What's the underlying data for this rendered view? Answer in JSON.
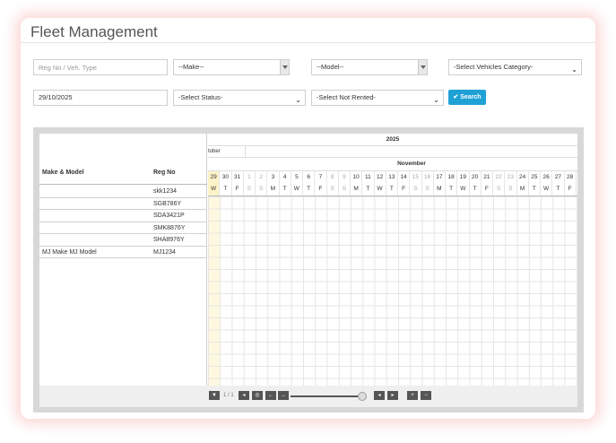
{
  "page": {
    "title": "Fleet Management"
  },
  "filters": {
    "reg_placeholder": "Reg No / Veh. Type",
    "make": "--Make--",
    "model": "--Model--",
    "vehicle_category": "-Select Vehicles Category-",
    "date": "29/10/2025",
    "status": "-Select Status-",
    "not_rented": "-Select Not Rented-",
    "search_label": "Search"
  },
  "gantt": {
    "year": "2025",
    "month_partial": "tober",
    "month_main": "November",
    "headers": {
      "make_model": "Make & Model",
      "reg_no": "Reg No"
    },
    "rows": [
      {
        "make_model": "",
        "reg_no": "skk1234"
      },
      {
        "make_model": "",
        "reg_no": "SGB786Y"
      },
      {
        "make_model": "",
        "reg_no": "SDA3421P"
      },
      {
        "make_model": "",
        "reg_no": "SMK8876Y"
      },
      {
        "make_model": "",
        "reg_no": "SHA8976Y"
      },
      {
        "make_model": "MJ Make MJ Model",
        "reg_no": "MJ1234"
      }
    ],
    "days": [
      {
        "d": "29",
        "w": "W",
        "weekend": false,
        "today": true
      },
      {
        "d": "30",
        "w": "T",
        "weekend": false
      },
      {
        "d": "31",
        "w": "F",
        "weekend": false
      },
      {
        "d": "1",
        "w": "S",
        "weekend": true
      },
      {
        "d": "2",
        "w": "S",
        "weekend": true
      },
      {
        "d": "3",
        "w": "M",
        "weekend": false
      },
      {
        "d": "4",
        "w": "T",
        "weekend": false
      },
      {
        "d": "5",
        "w": "W",
        "weekend": false
      },
      {
        "d": "6",
        "w": "T",
        "weekend": false
      },
      {
        "d": "7",
        "w": "F",
        "weekend": false
      },
      {
        "d": "8",
        "w": "S",
        "weekend": true
      },
      {
        "d": "9",
        "w": "S",
        "weekend": true
      },
      {
        "d": "10",
        "w": "M",
        "weekend": false
      },
      {
        "d": "11",
        "w": "T",
        "weekend": false
      },
      {
        "d": "12",
        "w": "W",
        "weekend": false
      },
      {
        "d": "13",
        "w": "T",
        "weekend": false
      },
      {
        "d": "14",
        "w": "F",
        "weekend": false
      },
      {
        "d": "15",
        "w": "S",
        "weekend": true
      },
      {
        "d": "16",
        "w": "S",
        "weekend": true
      },
      {
        "d": "17",
        "w": "M",
        "weekend": false
      },
      {
        "d": "18",
        "w": "T",
        "weekend": false
      },
      {
        "d": "19",
        "w": "W",
        "weekend": false
      },
      {
        "d": "20",
        "w": "T",
        "weekend": false
      },
      {
        "d": "21",
        "w": "F",
        "weekend": false
      },
      {
        "d": "22",
        "w": "S",
        "weekend": true
      },
      {
        "d": "23",
        "w": "S",
        "weekend": true
      },
      {
        "d": "24",
        "w": "M",
        "weekend": false
      },
      {
        "d": "25",
        "w": "T",
        "weekend": false
      },
      {
        "d": "26",
        "w": "W",
        "weekend": false
      },
      {
        "d": "27",
        "w": "T",
        "weekend": false
      },
      {
        "d": "28",
        "w": "F",
        "weekend": false
      }
    ],
    "pager": "1 / 1"
  }
}
